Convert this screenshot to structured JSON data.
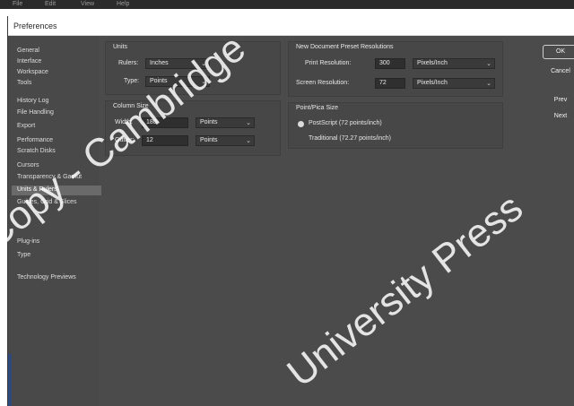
{
  "app_menu": [
    "File",
    "Edit",
    "View",
    "Help"
  ],
  "dialog": {
    "title": "Preferences"
  },
  "sidebar": {
    "items": [
      {
        "label": "General",
        "active": false
      },
      {
        "label": "Interface",
        "active": false
      },
      {
        "label": "Workspace",
        "active": false
      },
      {
        "label": "Tools",
        "active": false
      },
      {
        "label": "History Log",
        "active": false
      },
      {
        "label": "File Handling",
        "active": false
      },
      {
        "label": "Export",
        "active": false
      },
      {
        "label": "Performance",
        "active": false
      },
      {
        "label": "Scratch Disks",
        "active": false
      },
      {
        "label": "Cursors",
        "active": false
      },
      {
        "label": "Transparency & Gamut",
        "active": false
      },
      {
        "label": "Units & Rulers",
        "active": true
      },
      {
        "label": "Guides, Grid & Slices",
        "active": false
      },
      {
        "label": "Plug-ins",
        "active": false
      },
      {
        "label": "Type",
        "active": false
      },
      {
        "label": "Technology Previews",
        "active": false
      }
    ]
  },
  "units": {
    "title": "Units",
    "rulers_label": "Rulers:",
    "rulers_value": "Inches",
    "type_label": "Type:",
    "type_value": "Points"
  },
  "column_size": {
    "title": "Column Size",
    "width_label": "Width:",
    "width_value": "180",
    "width_unit": "Points",
    "gutter_label": "Gutter:",
    "gutter_value": "12",
    "gutter_unit": "Points"
  },
  "new_doc": {
    "title": "New Document Preset Resolutions",
    "print_label": "Print Resolution:",
    "print_value": "300",
    "print_unit": "Pixels/Inch",
    "screen_label": "Screen Resolution:",
    "screen_value": "72",
    "screen_unit": "Pixels/Inch"
  },
  "point_size": {
    "title": "Point/Pica Size",
    "option1": "PostScript (72 points/inch)",
    "option2_label": "Traditional (72.27 points/inch)"
  },
  "buttons": {
    "ok": "OK",
    "cancel": "Cancel",
    "prev": "Prev",
    "next": "Next"
  },
  "watermark": {
    "line1": "Copy - Cambridge",
    "line2": "University Press"
  }
}
